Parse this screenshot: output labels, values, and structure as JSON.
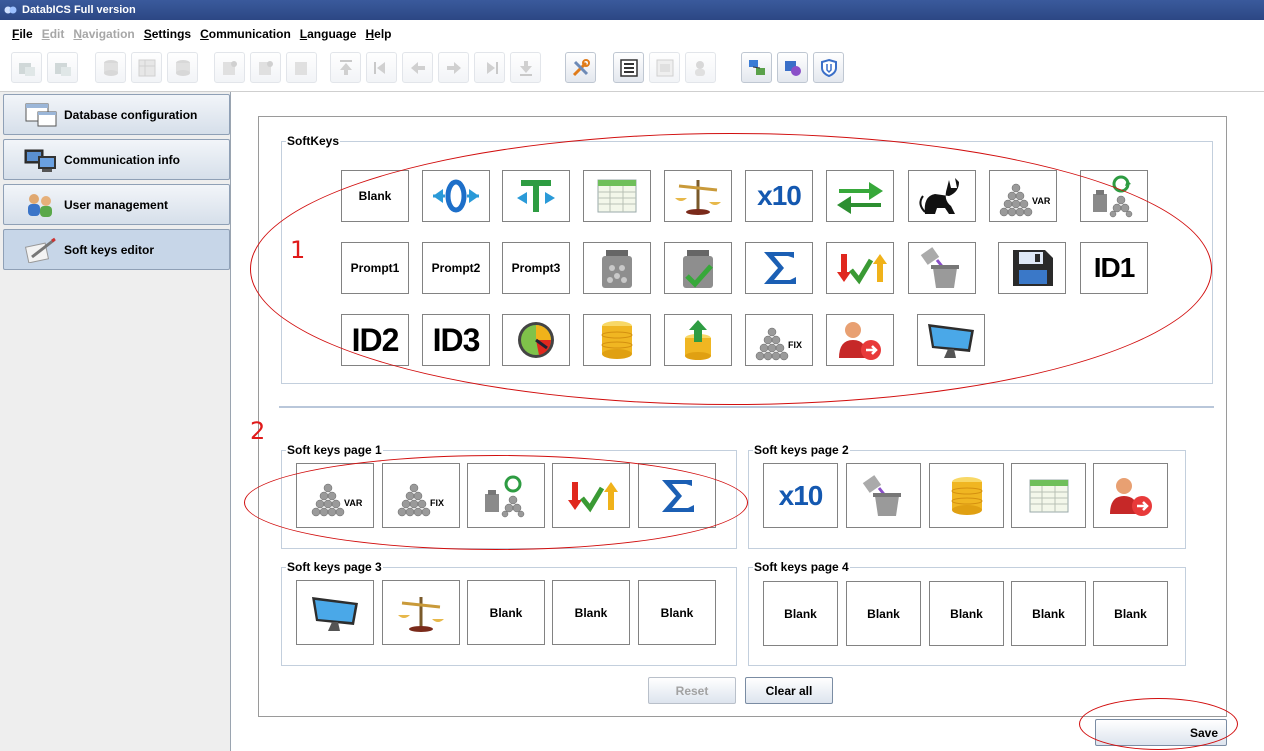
{
  "window": {
    "title": "DatabICS Full version"
  },
  "menu": {
    "items": [
      {
        "label": "File",
        "enabled": true
      },
      {
        "label": "Edit",
        "enabled": false
      },
      {
        "label": "Navigation",
        "enabled": false
      },
      {
        "label": "Settings",
        "enabled": true
      },
      {
        "label": "Communication",
        "enabled": true
      },
      {
        "label": "Language",
        "enabled": true
      },
      {
        "label": "Help",
        "enabled": true
      }
    ]
  },
  "sidebar": {
    "items": [
      {
        "label": "Database configuration",
        "icon": "database-window-icon"
      },
      {
        "label": "Communication info",
        "icon": "computers-icon"
      },
      {
        "label": "User management",
        "icon": "users-icon"
      },
      {
        "label": "Soft keys editor",
        "icon": "pencil-icon",
        "active": true
      }
    ]
  },
  "softkeys": {
    "legend": "SoftKeys",
    "text_keys": {
      "blank": "Blank",
      "prompt1": "Prompt1",
      "prompt2": "Prompt2",
      "prompt3": "Prompt3",
      "id1": "ID1",
      "id2": "ID2",
      "id3": "ID3",
      "x10": "x10",
      "var": "VAR",
      "fix": "FIX"
    }
  },
  "pages": {
    "page1": {
      "legend": "Soft keys page 1"
    },
    "page2": {
      "legend": "Soft keys page 2"
    },
    "page3": {
      "legend": "Soft keys page 3",
      "blank": "Blank"
    },
    "page4": {
      "legend": "Soft keys page 4",
      "blank": "Blank"
    }
  },
  "buttons": {
    "reset": "Reset",
    "clear_all": "Clear all",
    "save": "Save"
  },
  "annotations": {
    "one": "1",
    "two": "2"
  },
  "colors": {
    "annotation": "#e01a1a",
    "title_bar": "#2c4784",
    "group_border": "#c3cfdd"
  }
}
